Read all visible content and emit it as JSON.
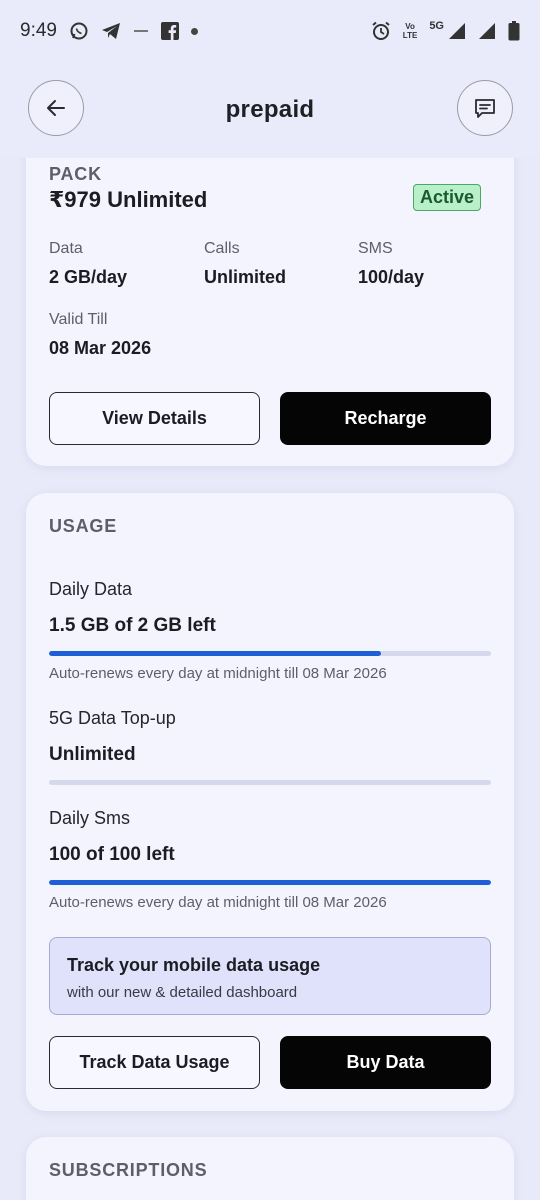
{
  "status_bar": {
    "time": "9:49",
    "left_icons": [
      "whatsapp-icon",
      "telegram-icon",
      "small-app-icon",
      "facebook-icon",
      "dot-icon"
    ],
    "volte_label_1": "Vo",
    "volte_label_2": "LTE",
    "network": "5G",
    "right_icons": [
      "alarm-icon",
      "signal-icon",
      "signal-icon",
      "battery-icon"
    ]
  },
  "header": {
    "title": "prepaid",
    "back_icon": "arrow-left-icon",
    "chat_icon": "chat-icon"
  },
  "pack": {
    "section_label": "PACK",
    "name": "₹979 Unlimited",
    "status_badge": "Active",
    "data_label": "Data",
    "data_value": "2 GB/day",
    "calls_label": "Calls",
    "calls_value": "Unlimited",
    "sms_label": "SMS",
    "sms_value": "100/day",
    "valid_label": "Valid Till",
    "valid_value": "08 Mar 2026",
    "view_details_label": "View Details",
    "recharge_label": "Recharge"
  },
  "usage": {
    "section_label": "USAGE",
    "items": [
      {
        "title": "Daily Data",
        "value": "1.5 GB of 2 GB left",
        "fill_fraction": 0.75,
        "note": "Auto-renews every day at midnight till 08 Mar 2026"
      },
      {
        "title": "5G Data Top-up",
        "value": "Unlimited",
        "fill_fraction": 0,
        "note": ""
      },
      {
        "title": "Daily Sms",
        "value": "100 of 100 left",
        "fill_fraction": 1.0,
        "note": "Auto-renews every day at midnight till 08 Mar 2026"
      }
    ],
    "promo_title": "Track your mobile data usage",
    "promo_subtitle": "with our new & detailed dashboard",
    "track_button_label": "Track Data Usage",
    "buy_button_label": "Buy Data"
  },
  "subscriptions": {
    "section_label": "SUBSCRIPTIONS"
  },
  "colors": {
    "accent_blue": "#1e5fd8",
    "active_green": "#b9efc9",
    "background": "#e9eaf9"
  }
}
